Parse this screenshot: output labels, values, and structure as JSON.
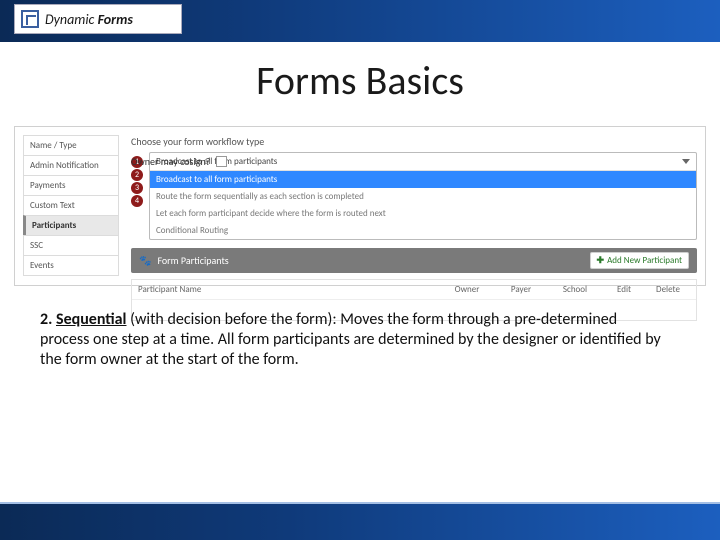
{
  "header": {
    "logo_text_prefix": "Dynamic ",
    "logo_text_bold": "Forms"
  },
  "title": "Forms Basics",
  "screenshot": {
    "side_tabs": [
      {
        "label": "Name / Type",
        "active": false
      },
      {
        "label": "Admin Notification",
        "active": false
      },
      {
        "label": "Payments",
        "active": false
      },
      {
        "label": "Custom Text",
        "active": false
      },
      {
        "label": "Participants",
        "active": true
      },
      {
        "label": "SSC",
        "active": false
      },
      {
        "label": "Events",
        "active": false
      }
    ],
    "workflow_label": "Choose your form workflow type",
    "cosign_label": "Owner may cosign?",
    "dropdown": {
      "selected": "Broadcast to all form participants",
      "options": [
        "Broadcast to all form participants",
        "Route the form sequentially as each section is completed",
        "Let each form participant decide where the form is routed next",
        "Conditional Routing"
      ]
    },
    "badges": [
      "1",
      "2",
      "3",
      "4"
    ],
    "fp_header": "Form Participants",
    "add_participant": "Add New Participant",
    "table": {
      "cols": {
        "name": "Participant Name",
        "owner": "Owner",
        "payer": "Payer",
        "school": "School",
        "edit": "Edit",
        "delete": "Delete"
      }
    }
  },
  "explain": {
    "lead_num": "2. ",
    "lead_word": "Sequential",
    "rest": " (with decision before the form): Moves the form through a pre-determined process one step at a time. All form participants are determined by the designer or identified by the form owner at the start of the form."
  }
}
